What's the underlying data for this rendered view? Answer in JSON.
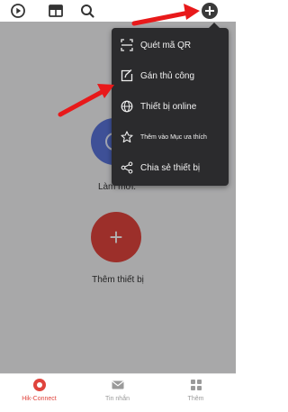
{
  "topbar": {
    "icons": [
      "play-icon",
      "layout-icon",
      "search-icon",
      "add-icon"
    ]
  },
  "home": {
    "recent_button_label": "Làm mới.",
    "add_device_label": "Thêm thiết bị",
    "add_button_symbol": "+"
  },
  "menu": {
    "items": [
      {
        "label": "Quét mã QR",
        "icon": "qr-scan-icon"
      },
      {
        "label": "Gán thủ công",
        "icon": "edit-icon"
      },
      {
        "label": "Thiết bị online",
        "icon": "globe-icon"
      },
      {
        "label": "Thêm vào Mục ưa thích",
        "icon": "star-icon"
      },
      {
        "label": "Chia sẻ thiết bị",
        "icon": "share-icon"
      }
    ]
  },
  "bottomnav": {
    "items": [
      {
        "label": "Hik-Connect",
        "icon": "hik-connect-icon",
        "active": true
      },
      {
        "label": "Tin nhắn",
        "icon": "mail-icon",
        "active": false
      },
      {
        "label": "Thêm",
        "icon": "grid-icon",
        "active": false
      }
    ]
  },
  "colors": {
    "accent": "#e0443d",
    "menu_bg": "#2b2b2d",
    "arrow": "#e8191a"
  }
}
